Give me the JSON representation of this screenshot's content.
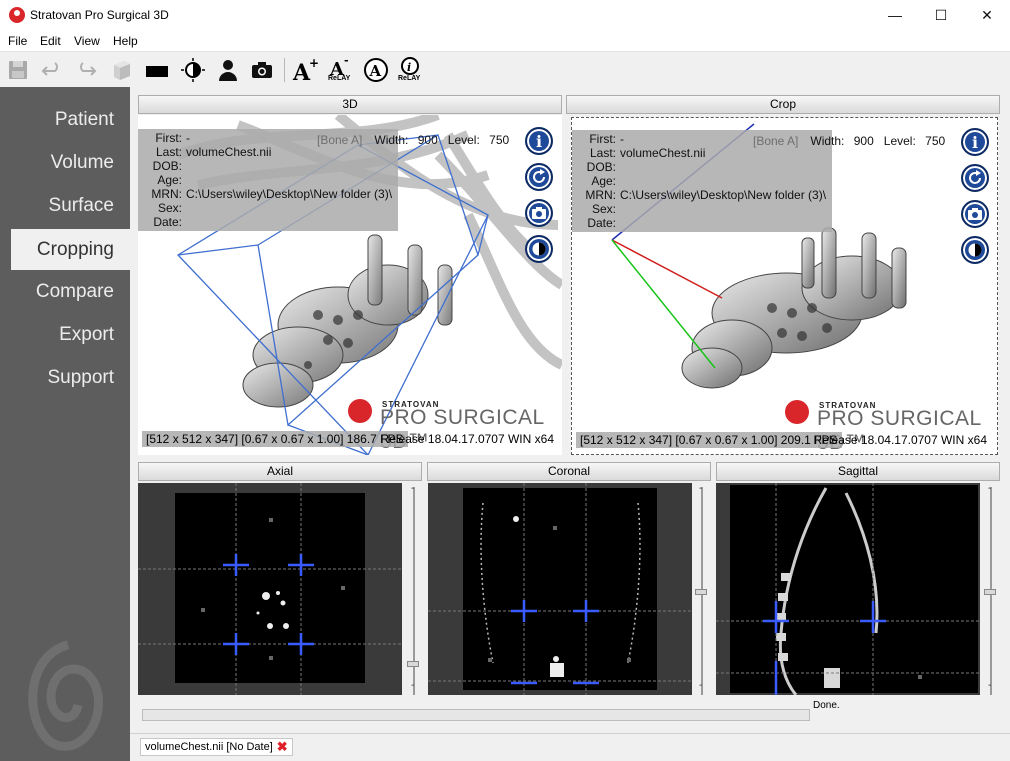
{
  "window": {
    "title": "Stratovan Pro Surgical 3D",
    "minimize_glyph": "—",
    "maximize_glyph": "☐",
    "close_glyph": "✕"
  },
  "menu": {
    "file": "File",
    "edit": "Edit",
    "view": "View",
    "help": "Help"
  },
  "toolbar": {
    "icons": [
      "save-icon",
      "undo-icon",
      "redo-icon",
      "cube-icon",
      "black-rect-icon",
      "contrast-icon",
      "person-icon",
      "camera-icon",
      "font-increase-icon",
      "font-decrease-icon",
      "annotation-icon",
      "info-relay-icon"
    ],
    "relay_label": "ReLAY"
  },
  "sidebar": {
    "items": [
      {
        "label": "Patient"
      },
      {
        "label": "Volume"
      },
      {
        "label": "Surface"
      },
      {
        "label": "Cropping",
        "active": true
      },
      {
        "label": "Compare"
      },
      {
        "label": "Export"
      },
      {
        "label": "Support"
      }
    ]
  },
  "views": {
    "view3d": {
      "header": "3D",
      "first_key": "First:",
      "first_val": "-",
      "last_key": "Last:",
      "last_val": "volumeChest.nii",
      "dob_key": "DOB:",
      "dob_val": "",
      "age_key": "Age:",
      "age_val": "",
      "mrn_key": "MRN:",
      "mrn_val": "C:\\Users\\wiley\\Desktop\\New folder (3)\\",
      "sex_key": "Sex:",
      "sex_val": "",
      "date_key": "Date:",
      "date_val": "",
      "preset": "[Bone A]",
      "width_label": "Width:",
      "width_val": "900",
      "level_label": "Level:",
      "level_val": "750",
      "dims": "[512 x 512 x 347] [0.67 x 0.67 x 1.00] 186.7 FPS",
      "version": "Release 18.04.17.0707 WIN x64",
      "brand_small": "STRATOVAN",
      "brand_big": "PRO SURGICAL 3D™"
    },
    "crop": {
      "header": "Crop",
      "first_key": "First:",
      "first_val": "-",
      "last_key": "Last:",
      "last_val": "volumeChest.nii",
      "dob_key": "DOB:",
      "dob_val": "",
      "age_key": "Age:",
      "age_val": "",
      "mrn_key": "MRN:",
      "mrn_val": "C:\\Users\\wiley\\Desktop\\New folder (3)\\",
      "sex_key": "Sex:",
      "sex_val": "",
      "date_key": "Date:",
      "date_val": "",
      "preset": "[Bone A]",
      "width_label": "Width:",
      "width_val": "900",
      "level_label": "Level:",
      "level_val": "750",
      "dims": "[512 x 512 x 347] [0.67 x 0.67 x 1.00] 209.1 FPS",
      "version": "Release 18.04.17.0707 WIN x64",
      "brand_small": "STRATOVAN",
      "brand_big": "PRO SURGICAL 3D™"
    },
    "overlay_buttons": [
      "info-icon",
      "reset-rotation-icon",
      "camera-icon",
      "contrast-icon"
    ],
    "axial": {
      "header": "Axial"
    },
    "coronal": {
      "header": "Coronal"
    },
    "sagittal": {
      "header": "Sagittal"
    }
  },
  "status": {
    "text": "Done.",
    "progress": 0
  },
  "tabs": [
    {
      "label": "volumeChest.nii [No Date]"
    }
  ]
}
